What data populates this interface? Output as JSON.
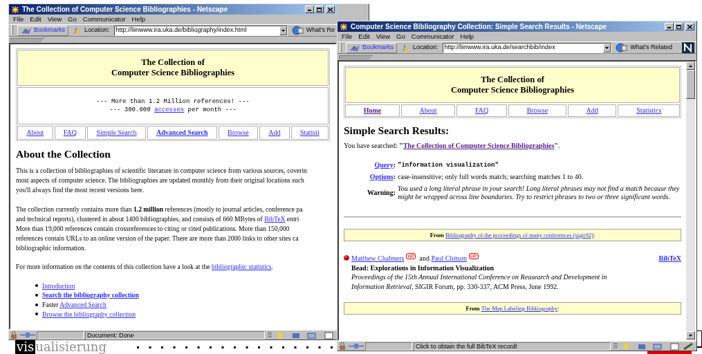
{
  "left_window": {
    "title": "The Collection of Computer Science Bibliographies - Netscape",
    "menu": [
      "File",
      "Edit",
      "View",
      "Go",
      "Communicator",
      "Help"
    ],
    "toolbar": {
      "bookmarks": "Bookmarks",
      "location_label": "Location:",
      "url": "http://liinwww.ira.uka.de/bibliography/index.html",
      "related": "What's Re"
    },
    "page": {
      "header": [
        "The Collection of",
        "Computer Science Bibliographies"
      ],
      "banner": [
        [
          {
            "text": "--- More than 1.2 Million references! ---",
            "kind": "plain"
          }
        ],
        [
          {
            "text": "--- 300.000 ",
            "kind": "plain"
          },
          {
            "text": "accesses",
            "kind": "link"
          },
          {
            "text": " per month ---",
            "kind": "plain"
          }
        ]
      ],
      "nav": [
        {
          "label": "About",
          "bold": false,
          "visited": false
        },
        {
          "label": "FAQ",
          "bold": false,
          "visited": false
        },
        {
          "label": "Simple Search",
          "bold": false,
          "visited": false
        },
        {
          "label": "Advanced Search",
          "bold": true,
          "visited": false
        },
        {
          "label": "Browse",
          "bold": false,
          "visited": false
        },
        {
          "label": "Add",
          "bold": false,
          "visited": false
        },
        {
          "label": "Statisti",
          "bold": false,
          "visited": false
        }
      ],
      "heading": "About the Collection",
      "paragraphs": [
        [
          [
            {
              "text": "This is a collection of bibliographies of scientific literature in computer science from various sources, coverin",
              "kind": "plain"
            }
          ],
          [
            {
              "text": "most aspects of computer science. The bibliographies are updated monthly from their original locations such",
              "kind": "plain"
            }
          ],
          [
            {
              "text": "you'll always find the most recent versions here.",
              "kind": "plain"
            }
          ]
        ],
        [
          [
            {
              "text": "The collection currently contains more than ",
              "kind": "plain"
            },
            {
              "text": "1.2 million",
              "kind": "bold"
            },
            {
              "text": " references (mostly to journal articles, conference pa",
              "kind": "plain"
            }
          ],
          [
            {
              "text": "and technical reports), clustered in about 1400 bibliographies, and consists of 660 MBytes of ",
              "kind": "plain"
            },
            {
              "text": "BibTeX",
              "kind": "link"
            },
            {
              "text": " entri",
              "kind": "plain"
            }
          ],
          [
            {
              "text": "More than 19,000 references contain crossreferences to citing or cited publications. More than 150,000",
              "kind": "plain"
            }
          ],
          [
            {
              "text": "references contain URLs to an online version of the paper. There are more than 2000 links to other sites ca",
              "kind": "plain"
            }
          ],
          [
            {
              "text": "bibliographic information.",
              "kind": "plain"
            }
          ]
        ],
        [
          [
            {
              "text": "For more information on the contents of this collection have a look at the ",
              "kind": "plain"
            },
            {
              "text": "bibliographic statistics",
              "kind": "link"
            },
            {
              "text": ".",
              "kind": "plain"
            }
          ]
        ]
      ],
      "list": [
        [
          {
            "text": "Introduction",
            "kind": "link"
          }
        ],
        [
          {
            "text": "Search the bibliography collection",
            "kind": "boldlink"
          }
        ],
        [
          {
            "text": "Faster ",
            "kind": "plain"
          },
          {
            "text": "Advanced Search",
            "kind": "link"
          }
        ],
        [
          {
            "text": "Browse the bibliography collection",
            "kind": "link"
          }
        ]
      ]
    },
    "status_bar": "Document: Done"
  },
  "right_window": {
    "title": "Computer Science Bibliography Collection: Simple Search Results - Netscape",
    "menu": [
      "File",
      "Edit",
      "View",
      "Go",
      "Communicator",
      "Help"
    ],
    "toolbar": {
      "bookmarks": "Bookmarks",
      "location_label": "Location:",
      "url": "http://liinwww.ira.uka.de/searchbib/index",
      "related": "What's Related"
    },
    "page": {
      "header": [
        "The Collection of",
        "Computer Science Bibliographies"
      ],
      "nav": [
        {
          "label": "Home",
          "bold": true,
          "visited": true
        },
        {
          "label": "About",
          "bold": false,
          "visited": false
        },
        {
          "label": "FAQ",
          "bold": false,
          "visited": false
        },
        {
          "label": "Browse",
          "bold": false,
          "visited": false
        },
        {
          "label": "Add",
          "bold": false,
          "visited": false
        },
        {
          "label": "Statistics",
          "bold": false,
          "visited": false
        }
      ],
      "heading": "Simple Search Results:",
      "searched": [
        {
          "text": "You have searched: ",
          "kind": "plain"
        },
        {
          "text": "\"",
          "kind": "bold"
        },
        {
          "text": "The Collection of Computer Science Bibliographies",
          "kind": "visitedboldlink"
        },
        {
          "text": "\"",
          "kind": "bold"
        },
        {
          "text": ".",
          "kind": "plain"
        }
      ],
      "fields": [
        {
          "label": [
            {
              "text": "Query",
              "kind": "boldlink"
            },
            {
              "text": ":",
              "kind": "bold"
            }
          ],
          "kind": "code",
          "value": "\"information visualization\""
        },
        {
          "label": [
            {
              "text": "Options",
              "kind": "boldlink"
            },
            {
              "text": ":",
              "kind": "bold"
            }
          ],
          "kind": "plain",
          "value": "case-insensitive; only full words match; searching matches 1 to 40."
        },
        {
          "label": [
            {
              "text": "Warning:",
              "kind": "bold"
            }
          ],
          "kind": "italic",
          "value": "You used a long literal phrase in your search! Long literal phrases may not find a match because they might be wrapped across line boundaries. Try to restrict phrases to two or three significant words."
        }
      ],
      "sources": [
        {
          "from": [
            {
              "text": "From ",
              "kind": "bold"
            },
            {
              "text": "Bibliography of the proceedings of many conferences (sigir92)",
              "kind": "link"
            },
            {
              "text": ":",
              "kind": "plain"
            }
          ],
          "entries": [
            {
              "authors": [
                {
                  "text": "Matthew Chalmers",
                  "kind": "link"
                },
                {
                  "text": "HP",
                  "kind": "badge"
                },
                {
                  "text": " and ",
                  "kind": "plain"
                },
                {
                  "text": "Paul Chitson",
                  "kind": "link"
                },
                {
                  "text": "HP",
                  "kind": "badge"
                }
              ],
              "bibtex": "BibTeX",
              "title": "Bead: Explorations in Information Visualization",
              "citation": "*Proceedings of the 15th Annual International Conference on Reasearch and Development in Information Retrieval*, SIGIR Forum, pp. 330-337, ACM Press, June 1992."
            }
          ]
        },
        {
          "from": [
            {
              "text": "From ",
              "kind": "bold"
            },
            {
              "text": "The Map Labeling Bibliography",
              "kind": "link"
            },
            {
              "text": ":",
              "kind": "plain"
            }
          ]
        }
      ]
    },
    "status_bar": "Click to obtain the full BibTeX record!"
  },
  "logo": {
    "dark_part": "vis",
    "light_part": "ualisierung"
  }
}
